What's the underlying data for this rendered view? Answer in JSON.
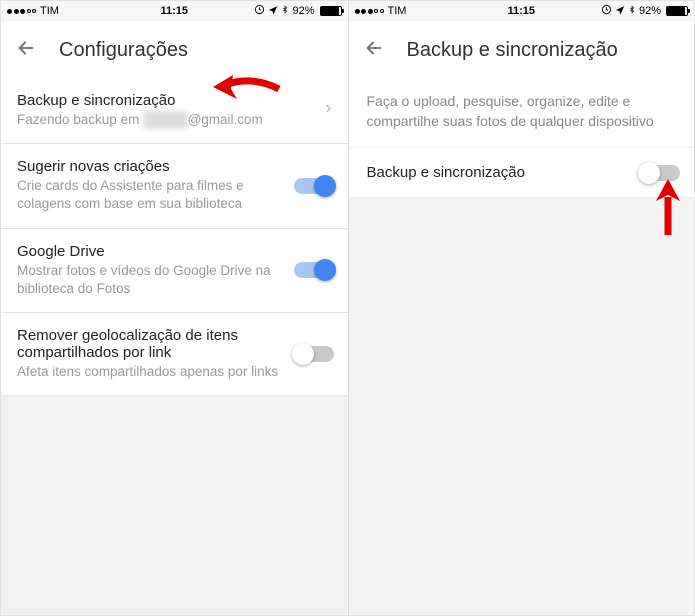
{
  "status": {
    "carrier": "TIM",
    "time": "11:15",
    "battery_pct": "92%"
  },
  "left": {
    "title": "Configurações",
    "items": [
      {
        "title": "Backup e sincronização",
        "sub_prefix": "Fazendo backup em ",
        "sub_hidden": "xxxxxx",
        "sub_suffix": "@gmail.com"
      },
      {
        "title": "Sugerir novas criações",
        "sub": "Crie cards do Assistente para filmes e colagens com base em sua biblioteca"
      },
      {
        "title": "Google Drive",
        "sub": "Mostrar fotos e vídeos do Google Drive na biblioteca do Fotos"
      },
      {
        "title": "Remover geolocalização de itens compartilhados por link",
        "sub": "Afeta itens compartilhados apenas por links"
      }
    ]
  },
  "right": {
    "title": "Backup e sincronização",
    "description": "Faça o upload, pesquise, organize, edite e compartilhe suas fotos de qualquer dispositivo",
    "row_label": "Backup e sincronização"
  }
}
